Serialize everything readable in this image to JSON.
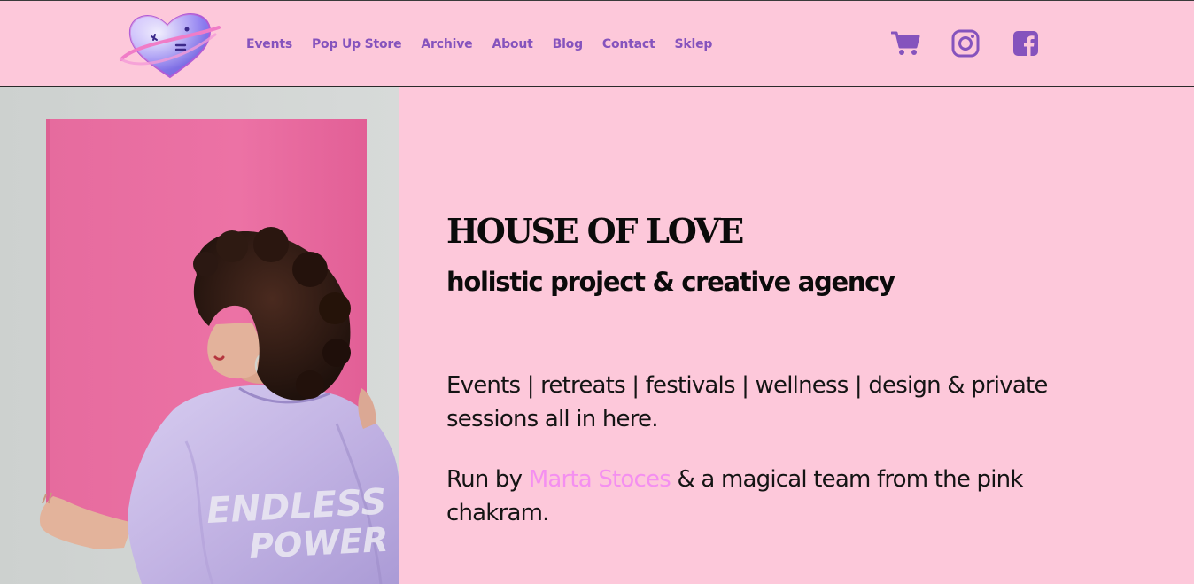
{
  "nav": {
    "items": [
      "Events",
      "Pop Up Store",
      "Archive",
      "About",
      "Blog",
      "Contact",
      "Sklep"
    ]
  },
  "icons": {
    "logo": "heart-logo",
    "cart": "shopping-cart-icon",
    "instagram": "instagram-icon",
    "facebook": "facebook-icon"
  },
  "photo": {
    "jacket_text_line1": "ENDLESS",
    "jacket_text_line2": "POWER"
  },
  "hero": {
    "title": "HOUSE OF LOVE",
    "subtitle": "holistic project & creative agency",
    "paragraph1": "Events | retreats | festivals | wellness | design & private sessions all in here.",
    "paragraph2_prefix": "Run by ",
    "paragraph2_link": "Marta Stoces",
    "paragraph2_suffix": " & a magical team from the pink chakram."
  },
  "colors": {
    "background": "#fdc8da",
    "nav_text": "#8553bd",
    "link_accent": "#f48ff0",
    "poster_pink": "#ea6a9f",
    "jacket_lavender": "#c6b7e6",
    "text": "#0b0b0b"
  }
}
